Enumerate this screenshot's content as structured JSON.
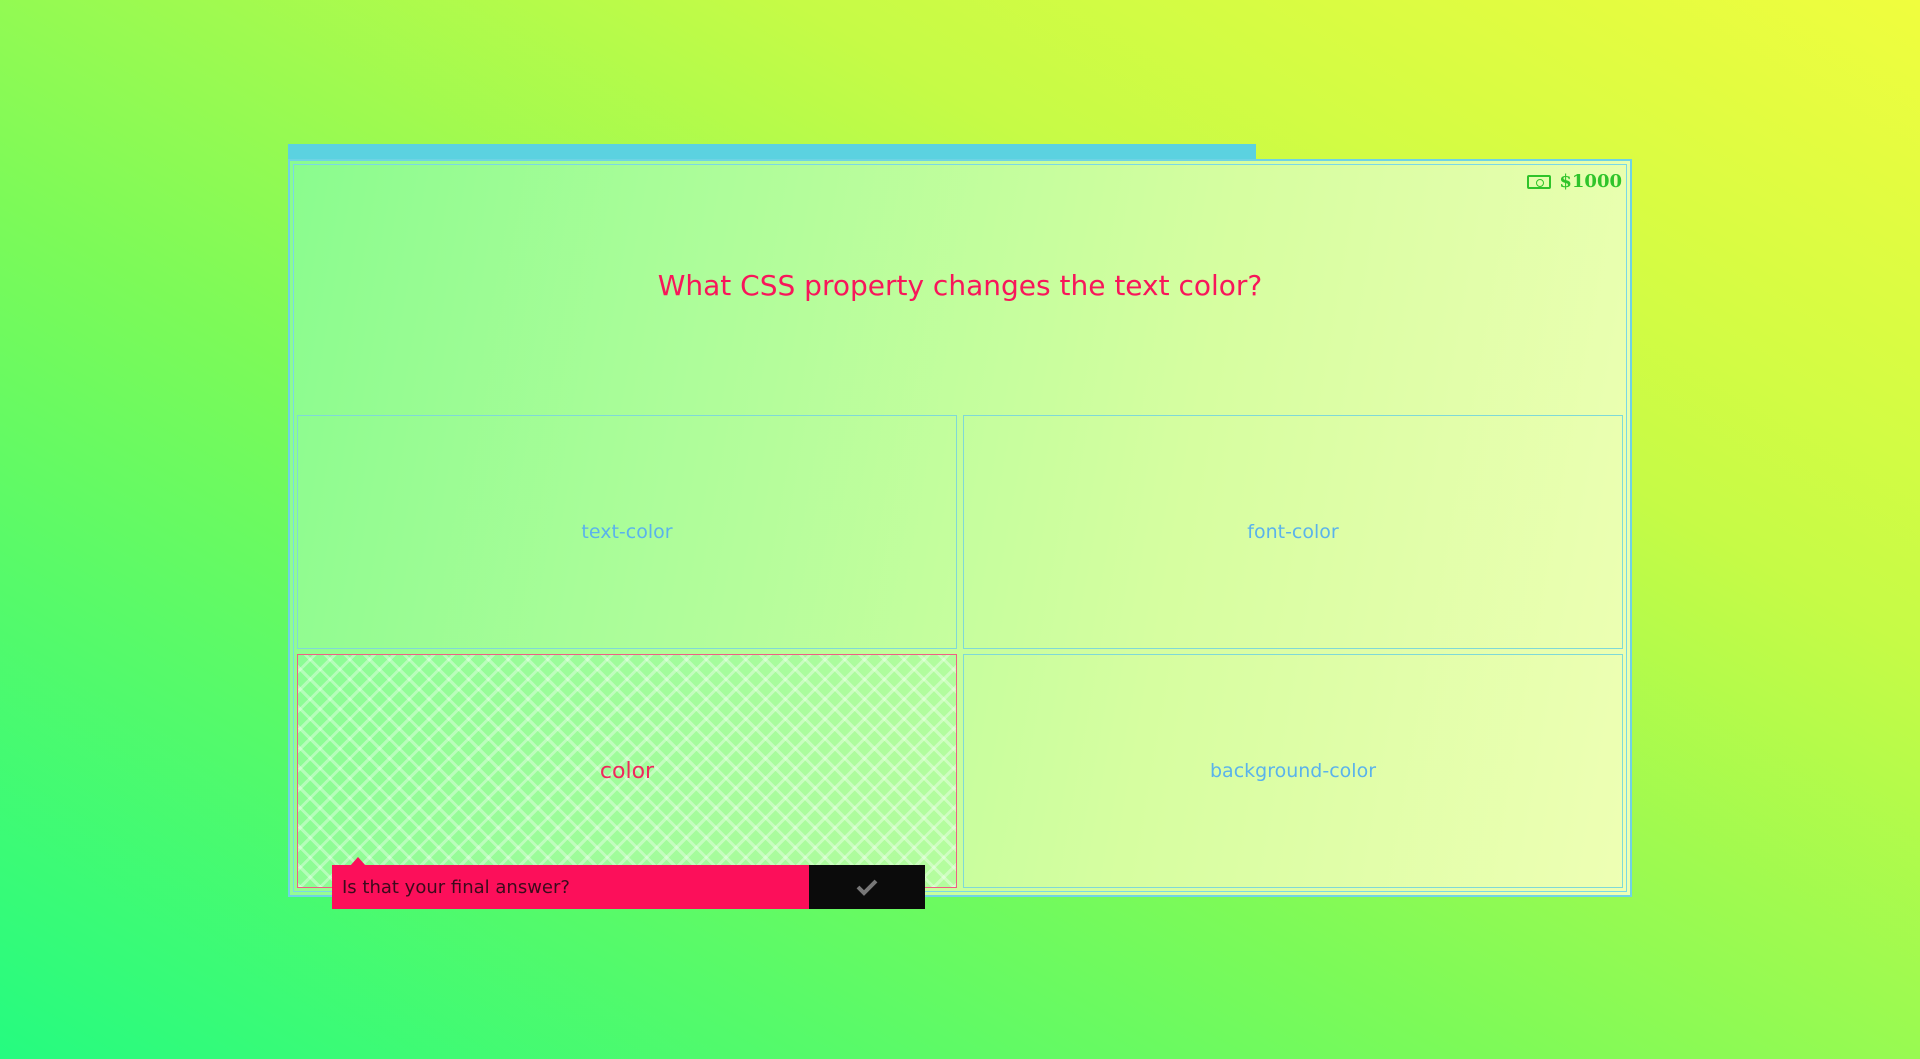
{
  "prize": {
    "icon": "money-icon",
    "amount": "$1000",
    "color": "#2fc42a"
  },
  "progress": {
    "fraction": 0.72,
    "color": "#5bd2e0"
  },
  "question": {
    "text": "What CSS property changes the text color?",
    "color": "#f8165a"
  },
  "answers": [
    {
      "label": "text-color",
      "selected": false
    },
    {
      "label": "font-color",
      "selected": false
    },
    {
      "label": "color",
      "selected": true
    },
    {
      "label": "background-color",
      "selected": false
    }
  ],
  "confirm": {
    "prompt": "Is that your final answer?",
    "button_icon": "checkmark-icon"
  },
  "colors": {
    "accent": "#fc0f5a",
    "answer_text": "#5ab2ec",
    "selected_text": "#f0285c"
  }
}
